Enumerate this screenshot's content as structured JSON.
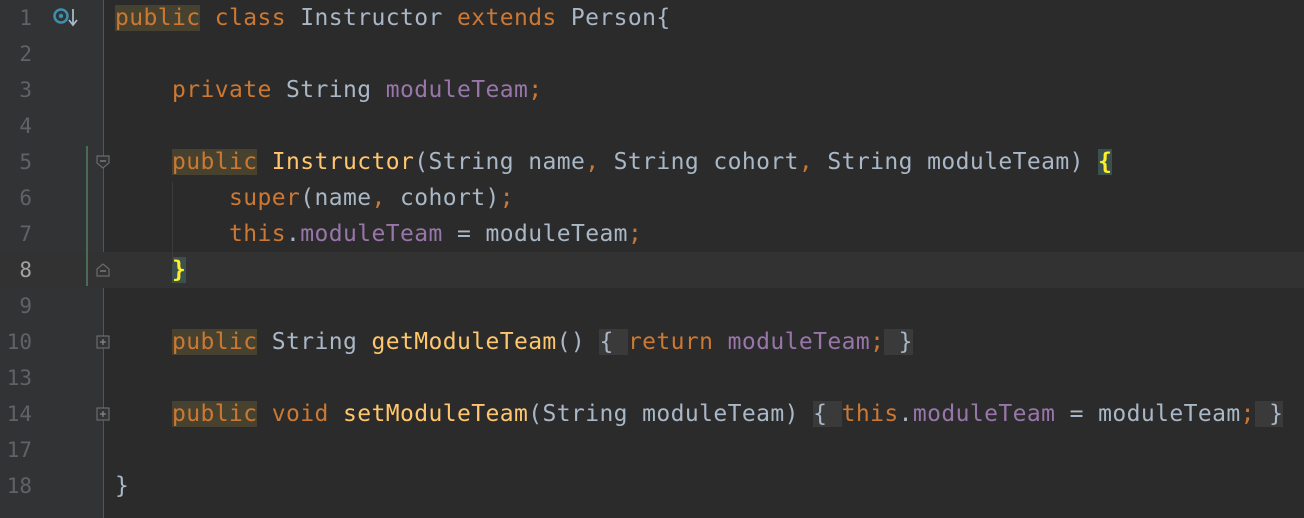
{
  "editor": {
    "lines": [
      {
        "num": "1",
        "parts": [
          {
            "t": "public",
            "c": "kwbg"
          },
          {
            "t": " ",
            "c": "txt"
          },
          {
            "t": "class",
            "c": "kw"
          },
          {
            "t": " Instructor ",
            "c": "txt"
          },
          {
            "t": "extends",
            "c": "kw"
          },
          {
            "t": " Person{",
            "c": "txt"
          }
        ]
      },
      {
        "num": "2",
        "parts": []
      },
      {
        "num": "3",
        "parts": [
          {
            "t": "    ",
            "c": "txt"
          },
          {
            "t": "private",
            "c": "kw"
          },
          {
            "t": " String ",
            "c": "txt"
          },
          {
            "t": "moduleTeam",
            "c": "fld"
          },
          {
            "t": ";",
            "c": "kw"
          }
        ]
      },
      {
        "num": "4",
        "parts": []
      },
      {
        "num": "5",
        "parts": [
          {
            "t": "    ",
            "c": "txt"
          },
          {
            "t": "public",
            "c": "kwbg"
          },
          {
            "t": " ",
            "c": "txt"
          },
          {
            "t": "Instructor",
            "c": "mth"
          },
          {
            "t": "(String name",
            "c": "txt"
          },
          {
            "t": ",",
            "c": "kw"
          },
          {
            "t": " String cohort",
            "c": "txt"
          },
          {
            "t": ",",
            "c": "kw"
          },
          {
            "t": " String moduleTeam) ",
            "c": "txt"
          },
          {
            "t": "{",
            "c": "brace-hl"
          }
        ]
      },
      {
        "num": "6",
        "parts": [
          {
            "t": "        ",
            "c": "txt"
          },
          {
            "t": "super",
            "c": "kw"
          },
          {
            "t": "(name",
            "c": "txt"
          },
          {
            "t": ",",
            "c": "kw"
          },
          {
            "t": " cohort)",
            "c": "txt"
          },
          {
            "t": ";",
            "c": "kw"
          }
        ]
      },
      {
        "num": "7",
        "parts": [
          {
            "t": "        ",
            "c": "txt"
          },
          {
            "t": "this",
            "c": "kw"
          },
          {
            "t": ".",
            "c": "txt"
          },
          {
            "t": "moduleTeam",
            "c": "fld"
          },
          {
            "t": " = moduleTeam",
            "c": "txt"
          },
          {
            "t": ";",
            "c": "kw"
          }
        ]
      },
      {
        "num": "8",
        "parts": [
          {
            "t": "    ",
            "c": "txt"
          },
          {
            "t": "}",
            "c": "brace-hl"
          }
        ]
      },
      {
        "num": "9",
        "parts": []
      },
      {
        "num": "10",
        "parts": [
          {
            "t": "    ",
            "c": "txt"
          },
          {
            "t": "public",
            "c": "kwbg"
          },
          {
            "t": " String ",
            "c": "txt"
          },
          {
            "t": "getModuleTeam",
            "c": "mth"
          },
          {
            "t": "() ",
            "c": "txt"
          },
          {
            "t": "{ ",
            "c": "fold-bg"
          },
          {
            "t": "return",
            "c": "kw"
          },
          {
            "t": " ",
            "c": "txt"
          },
          {
            "t": "moduleTeam",
            "c": "fld"
          },
          {
            "t": ";",
            "c": "kw"
          },
          {
            "t": " }",
            "c": "fold-bg"
          }
        ]
      },
      {
        "num": "13",
        "parts": []
      },
      {
        "num": "14",
        "parts": [
          {
            "t": "    ",
            "c": "txt"
          },
          {
            "t": "public",
            "c": "kwbg"
          },
          {
            "t": " ",
            "c": "txt"
          },
          {
            "t": "void",
            "c": "kw"
          },
          {
            "t": " ",
            "c": "txt"
          },
          {
            "t": "setModuleTeam",
            "c": "mth"
          },
          {
            "t": "(String moduleTeam) ",
            "c": "txt"
          },
          {
            "t": "{ ",
            "c": "fold-bg"
          },
          {
            "t": "this",
            "c": "kw"
          },
          {
            "t": ".",
            "c": "txt"
          },
          {
            "t": "moduleTeam",
            "c": "fld"
          },
          {
            "t": " = moduleTeam",
            "c": "txt"
          },
          {
            "t": ";",
            "c": "kw"
          },
          {
            "t": " }",
            "c": "fold-bg"
          }
        ]
      },
      {
        "num": "17",
        "parts": []
      },
      {
        "num": "18",
        "parts": [
          {
            "t": "}",
            "c": "txt"
          }
        ]
      }
    ],
    "current_line": "8"
  },
  "icons": {
    "override": "overrides-method-icon",
    "fold_open": "fold-collapse-icon",
    "fold_closed": "fold-expand-icon"
  },
  "colors": {
    "background": "#2b2b2b",
    "gutter": "#313335",
    "keyword": "#cc7832",
    "field": "#9876aa",
    "method": "#ffc66d",
    "text": "#a9b7c6",
    "line_number": "#606366",
    "brace_match": "#ffef28"
  }
}
